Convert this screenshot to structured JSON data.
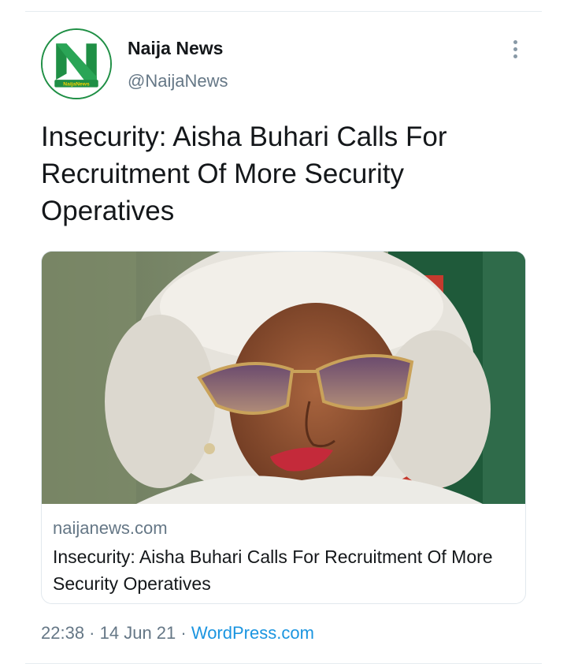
{
  "tweet": {
    "author": {
      "name": "Naija News",
      "handle": "@NaijaNews",
      "avatar_icon": "naija-news-logo",
      "avatar_caption": "NaijaNews",
      "brand_color": "#1f8f45"
    },
    "menu_icon": "more-vertical-icon",
    "text": "Insecurity: Aisha Buhari Calls For Recruitment Of More Security Operatives",
    "card": {
      "domain": "naijanews.com",
      "title": "Insecurity: Aisha Buhari Calls For Recruitment Of More Security Operatives",
      "image_subject": "woman-in-white-headwrap-photo"
    },
    "time": "22:38",
    "separator1": " · ",
    "date": "14 Jun 21",
    "separator2": " · ",
    "source": "WordPress.com",
    "colors": {
      "text": "#14171a",
      "secondary": "#657786",
      "link": "#1b95e0"
    }
  }
}
